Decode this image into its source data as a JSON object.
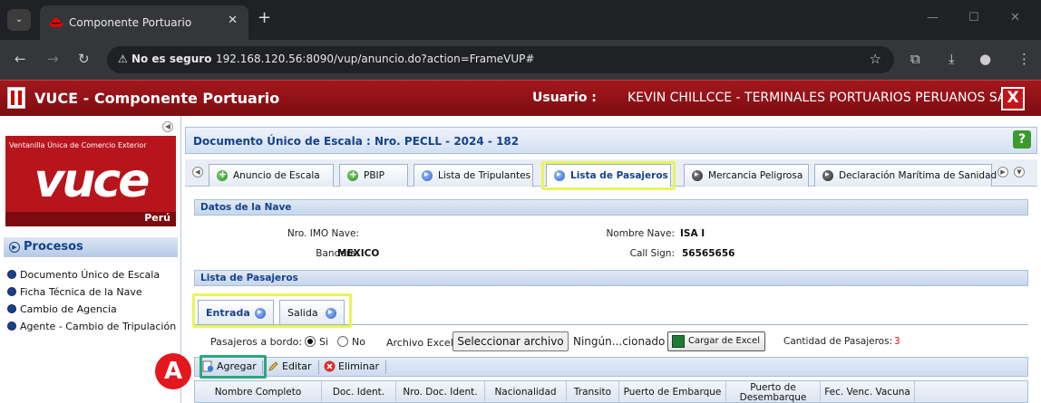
{
  "browser": {
    "tab_title": "Componente Portuario",
    "insecure_label": "No es seguro",
    "url": "192.168.120.56:8090/vup/anuncio.do?action=FrameVUP#"
  },
  "app": {
    "title": "VUCE - Componente Portuario",
    "user_label": "Usuario :",
    "user_name": "KEVIN CHILLCCE - TERMINALES PORTUARIOS PERUANOS SAC",
    "logout_label": "X"
  },
  "sidebar": {
    "logo_top": "Ventanilla Única de Comercio Exterior",
    "logo_text": "vuce",
    "logo_sub": "Perú",
    "section_title": "Procesos",
    "items": [
      {
        "label": "Documento Único de Escala"
      },
      {
        "label": "Ficha Técnica de la Nave"
      },
      {
        "label": "Cambio de Agencia"
      },
      {
        "label": "Agente - Cambio de Tripulación"
      }
    ]
  },
  "document": {
    "title": "Documento Único de Escala : Nro.  PECLL - 2024 - 182",
    "help_label": "?"
  },
  "tabs": [
    {
      "label": "Anuncio de Escala"
    },
    {
      "label": "PBIP"
    },
    {
      "label": "Lista de Tripulantes"
    },
    {
      "label": "Lista de Pasajeros"
    },
    {
      "label": "Mercancia Peligrosa"
    },
    {
      "label": "Declaración Marítima de Sanidad"
    }
  ],
  "ship": {
    "section_title": "Datos de la Nave",
    "imo_label": "Nro. IMO Nave:",
    "imo_value": "",
    "flag_label": "Bandera:",
    "flag_value": "MEXICO",
    "name_label": "Nombre Nave:",
    "name_value": "ISA I",
    "callsign_label": "Call Sign:",
    "callsign_value": "56565656"
  },
  "passengers": {
    "section_title": "Lista de Pasajeros",
    "subtabs": [
      {
        "label": "Entrada"
      },
      {
        "label": "Salida"
      }
    ],
    "onboard_label": "Pasajeros a bordo:",
    "yes_label": "Si",
    "no_label": "No",
    "excel_label": "Archivo Excel:",
    "file_button": "Seleccionar archivo",
    "file_status": "Ningún...cionado",
    "upload_button": "Cargar de Excel",
    "count_label": "Cantidad de Pasajeros:",
    "count_value": "3",
    "toolbar": {
      "add": "Agregar",
      "edit": "Editar",
      "delete": "Eliminar"
    },
    "columns": [
      "Nombre Completo",
      "Doc. Ident.",
      "Nro. Doc. Ident.",
      "Nacionalidad",
      "Transito",
      "Puerto de Embarque",
      "Puerto de Desembarque",
      "Fec. Venc. Vacuna"
    ]
  },
  "annotation": {
    "marker": "A"
  },
  "colors": {
    "brand_red": "#a3181d",
    "header_blue": "#15428b",
    "highlight_yellow": "#e8f55a",
    "highlight_green": "#2aa87b"
  }
}
